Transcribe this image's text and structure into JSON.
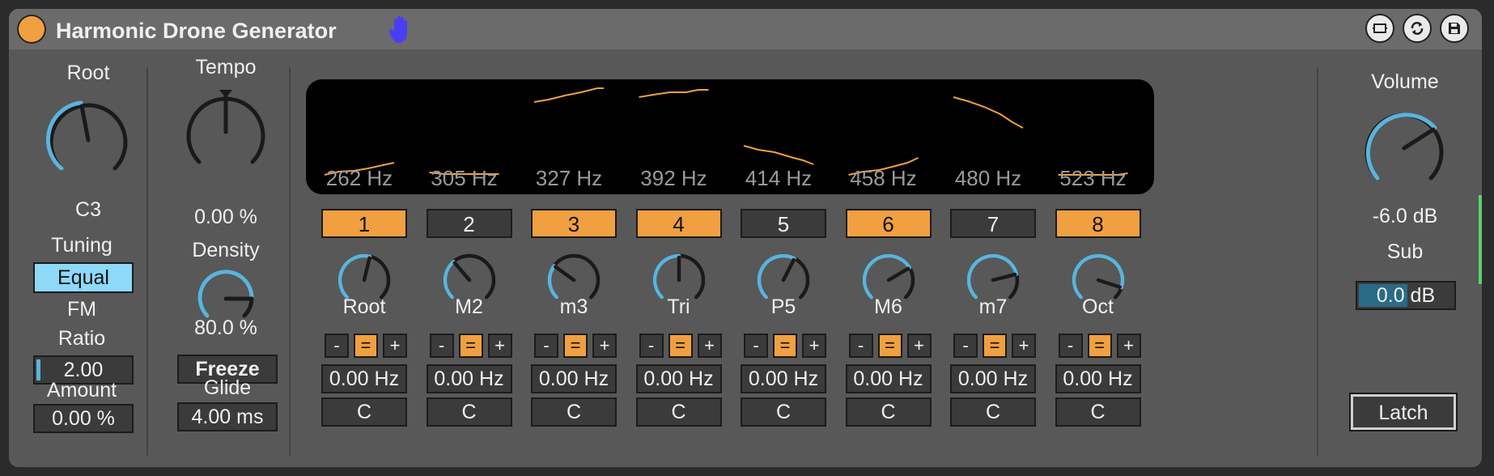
{
  "title": "Harmonic Drone Generator",
  "colors": {
    "accent": "#f0a040",
    "knob_arc": "#5ab4dc",
    "tuning_box": "#8ed8f8"
  },
  "left": {
    "root_label": "Root",
    "root_value": "C3",
    "tuning_label": "Tuning",
    "tuning_value": "Equal",
    "fm_label_1": "FM",
    "fm_label_2": "Ratio",
    "fm_value": "2.00",
    "amount_label": "Amount",
    "amount_value": "0.00 %"
  },
  "mid": {
    "tempo_label": "Tempo",
    "tempo_value": "0.00 %",
    "density_label": "Density",
    "density_value": "80.0 %",
    "freeze_label": "Freeze",
    "glide_label": "Glide",
    "glide_value": "4.00 ms"
  },
  "voices": [
    {
      "num": "1",
      "hz": "262 Hz",
      "name": "Root",
      "on": true,
      "level": 0.55,
      "offset": "0.00 Hz",
      "note": "C"
    },
    {
      "num": "2",
      "hz": "305 Hz",
      "name": "M2",
      "on": false,
      "level": 0.35,
      "offset": "0.00 Hz",
      "note": "C"
    },
    {
      "num": "3",
      "hz": "327 Hz",
      "name": "m3",
      "on": true,
      "level": 0.3,
      "offset": "0.00 Hz",
      "note": "C"
    },
    {
      "num": "4",
      "hz": "392 Hz",
      "name": "Tri",
      "on": true,
      "level": 0.5,
      "offset": "0.00 Hz",
      "note": "C"
    },
    {
      "num": "5",
      "hz": "414 Hz",
      "name": "P5",
      "on": false,
      "level": 0.6,
      "offset": "0.00 Hz",
      "note": "C"
    },
    {
      "num": "6",
      "hz": "458 Hz",
      "name": "M6",
      "on": true,
      "level": 0.72,
      "offset": "0.00 Hz",
      "note": "C"
    },
    {
      "num": "7",
      "hz": "480 Hz",
      "name": "m7",
      "on": false,
      "level": 0.78,
      "offset": "0.00 Hz",
      "note": "C"
    },
    {
      "num": "8",
      "hz": "523 Hz",
      "name": "Oct",
      "on": true,
      "level": 0.9,
      "offset": "0.00 Hz",
      "note": "C"
    }
  ],
  "step_labels": {
    "minus": "-",
    "equal": "=",
    "plus": "+"
  },
  "right": {
    "volume_label": "Volume",
    "volume_value": "-6.0 dB",
    "sub_label": "Sub",
    "sub_value": "0.0 dB",
    "latch_label": "Latch"
  }
}
